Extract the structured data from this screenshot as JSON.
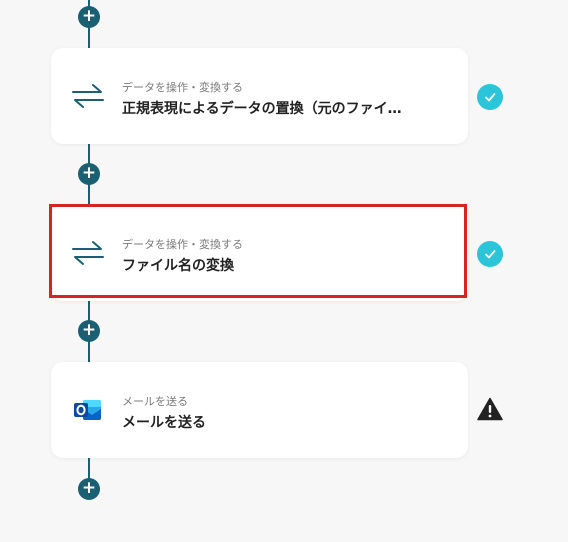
{
  "steps": [
    {
      "category": "データを操作・変換する",
      "title": "正規表現によるデータの置換（元のファイ…",
      "icon": "swap-arrows-icon",
      "status": "complete"
    },
    {
      "category": "データを操作・変換する",
      "title": "ファイル名の変換",
      "icon": "swap-arrows-icon",
      "status": "complete",
      "highlighted": true
    },
    {
      "category": "メールを送る",
      "title": "メールを送る",
      "icon": "outlook-icon",
      "status": "warning"
    }
  ],
  "add_step_symbol": "+",
  "colors": {
    "connector": "#1b5f73",
    "check": "#2bc4d9",
    "highlight": "#d62420",
    "warning": "#222222",
    "swap_icon": "#1b5f73",
    "outlook": "#0a64c8"
  }
}
